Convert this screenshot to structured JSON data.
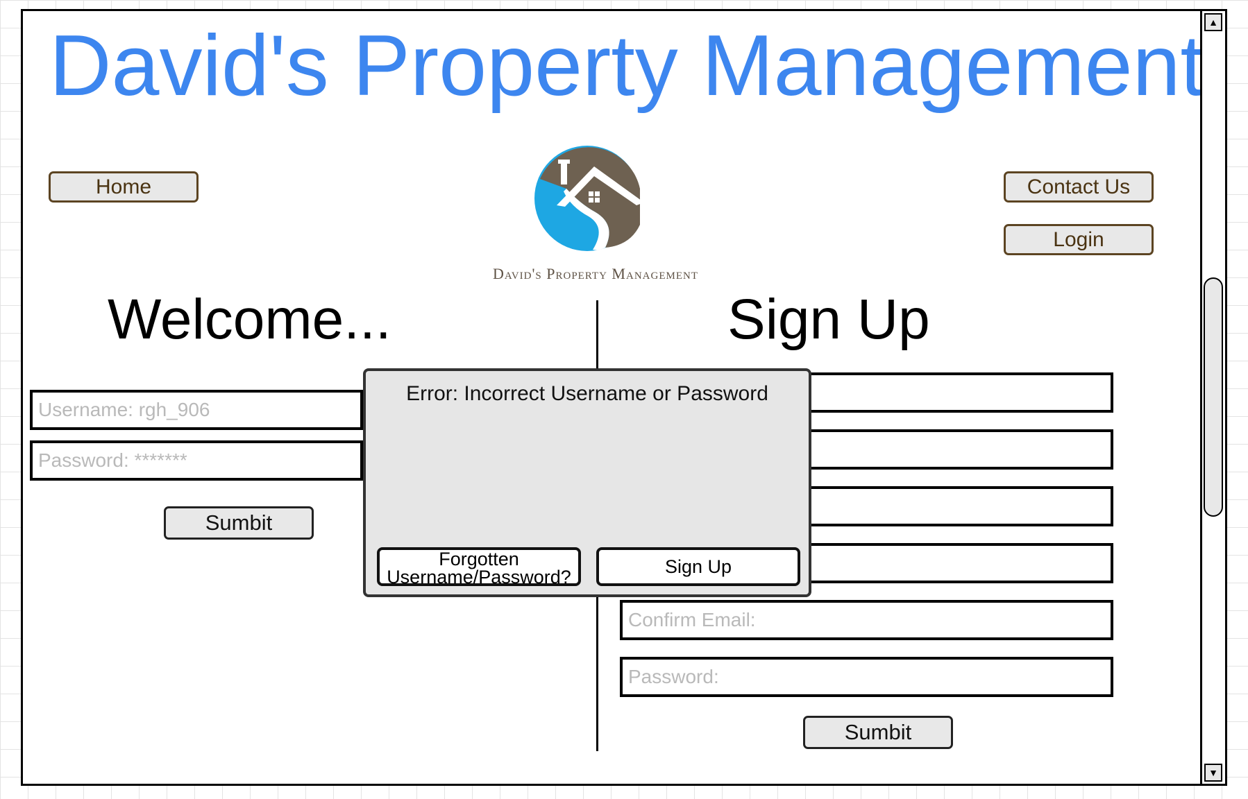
{
  "site": {
    "title": "David's Property Management",
    "logo_text": "David's Property Management"
  },
  "nav": {
    "home": "Home",
    "contact": "Contact Us",
    "login": "Login"
  },
  "login": {
    "heading": "Welcome...",
    "username_placeholder": "Username: rgh_906",
    "password_placeholder": "Password: *******",
    "submit": "Sumbit"
  },
  "signup": {
    "heading": "Sign Up",
    "field1_placeholder": "",
    "field2_placeholder": "",
    "field3_placeholder": "",
    "field4_placeholder": "",
    "confirm_email_placeholder": "Confirm Email:",
    "password_placeholder": "Password:",
    "submit": "Sumbit"
  },
  "error_dialog": {
    "message": "Error: Incorrect Username or Password",
    "forgot_line1": "Forgotten",
    "forgot_line2": "Username/Password?",
    "signup": "Sign Up"
  },
  "colors": {
    "title": "#3d86ef",
    "nav_border": "#5c4422",
    "logo_blue": "#1ea7e3",
    "logo_brown": "#6e6151"
  },
  "icons": {
    "scroll_up": "up-triangle-icon",
    "scroll_down": "down-triangle-icon",
    "logo": "house-logo-icon"
  }
}
